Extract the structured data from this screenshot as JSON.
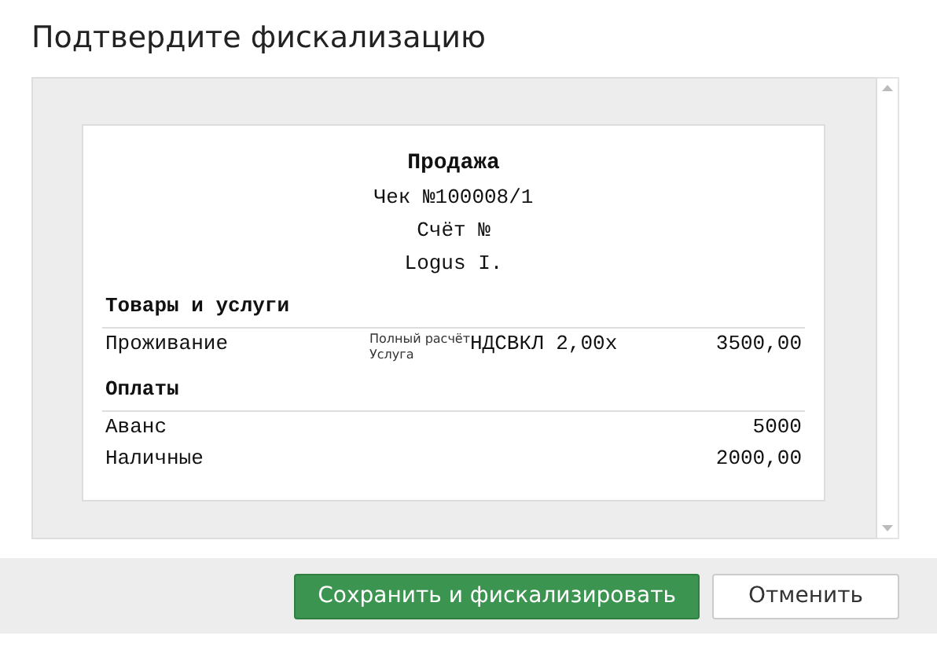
{
  "dialog": {
    "title": "Подтвердите фискализацию"
  },
  "receipt": {
    "header": [
      "Продажа",
      "Чек №100008/1",
      "Счёт №",
      "Logus I."
    ],
    "goods_title": "Товары и услуги",
    "goods": [
      {
        "name": "Проживание",
        "note": [
          "Полный расчёт",
          "Услуга"
        ],
        "tax": "НДСВКЛ 2,00x",
        "amount": "3500,00"
      }
    ],
    "payments_title": "Оплаты",
    "payments": [
      {
        "name": "Аванс",
        "amount": "5000"
      },
      {
        "name": "Наличные",
        "amount": "2000,00"
      }
    ]
  },
  "buttons": [
    {
      "label": "Сохранить и фискализировать",
      "kind": "primary"
    },
    {
      "label": "Отменить",
      "kind": "secondary"
    }
  ]
}
